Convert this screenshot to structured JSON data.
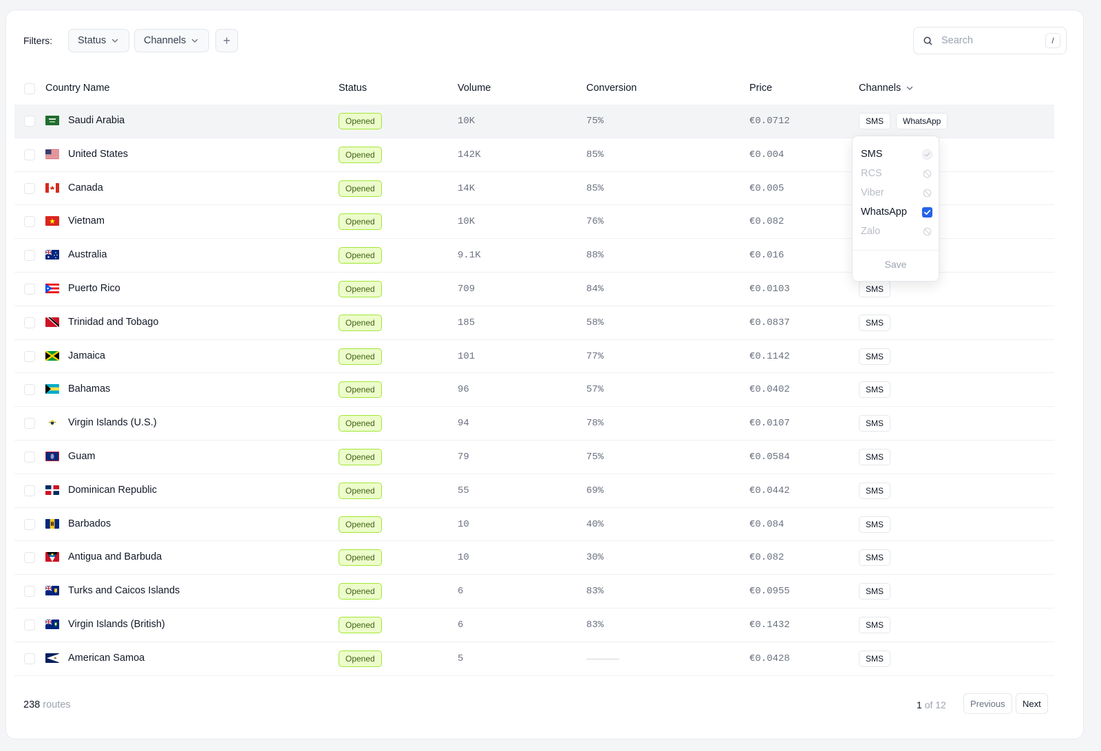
{
  "filters": {
    "label": "Filters:",
    "status_label": "Status",
    "channels_label": "Channels",
    "add_label": "+"
  },
  "search": {
    "placeholder": "Search",
    "shortcut": "/"
  },
  "table": {
    "headers": {
      "country": "Country Name",
      "status": "Status",
      "volume": "Volume",
      "conversion": "Conversion",
      "price": "Price",
      "channels": "Channels"
    },
    "rows": [
      {
        "country": "Saudi Arabia",
        "flag": "sa",
        "status": "Opened",
        "volume": "10K",
        "conversion": "75%",
        "price": "€0.0712",
        "channels": [
          "SMS",
          "WhatsApp"
        ]
      },
      {
        "country": "United States",
        "flag": "us",
        "status": "Opened",
        "volume": "142K",
        "conversion": "85%",
        "price": "€0.004",
        "channels": []
      },
      {
        "country": "Canada",
        "flag": "ca",
        "status": "Opened",
        "volume": "14K",
        "conversion": "85%",
        "price": "€0.005",
        "channels": []
      },
      {
        "country": "Vietnam",
        "flag": "vn",
        "status": "Opened",
        "volume": "10K",
        "conversion": "76%",
        "price": "€0.082",
        "channels": []
      },
      {
        "country": "Australia",
        "flag": "au",
        "status": "Opened",
        "volume": "9.1K",
        "conversion": "88%",
        "price": "€0.016",
        "channels": []
      },
      {
        "country": "Puerto Rico",
        "flag": "pr",
        "status": "Opened",
        "volume": "709",
        "conversion": "84%",
        "price": "€0.0103",
        "channels": [
          "SMS"
        ]
      },
      {
        "country": "Trinidad and Tobago",
        "flag": "tt",
        "status": "Opened",
        "volume": "185",
        "conversion": "58%",
        "price": "€0.0837",
        "channels": [
          "SMS"
        ]
      },
      {
        "country": "Jamaica",
        "flag": "jm",
        "status": "Opened",
        "volume": "101",
        "conversion": "77%",
        "price": "€0.1142",
        "channels": [
          "SMS"
        ]
      },
      {
        "country": "Bahamas",
        "flag": "bs",
        "status": "Opened",
        "volume": "96",
        "conversion": "57%",
        "price": "€0.0402",
        "channels": [
          "SMS"
        ]
      },
      {
        "country": "Virgin Islands (U.S.)",
        "flag": "vi",
        "status": "Opened",
        "volume": "94",
        "conversion": "78%",
        "price": "€0.0107",
        "channels": [
          "SMS"
        ]
      },
      {
        "country": "Guam",
        "flag": "gu",
        "status": "Opened",
        "volume": "79",
        "conversion": "75%",
        "price": "€0.0584",
        "channels": [
          "SMS"
        ]
      },
      {
        "country": "Dominican Republic",
        "flag": "do",
        "status": "Opened",
        "volume": "55",
        "conversion": "69%",
        "price": "€0.0442",
        "channels": [
          "SMS"
        ]
      },
      {
        "country": "Barbados",
        "flag": "bb",
        "status": "Opened",
        "volume": "10",
        "conversion": "40%",
        "price": "€0.084",
        "channels": [
          "SMS"
        ]
      },
      {
        "country": "Antigua and Barbuda",
        "flag": "ag",
        "status": "Opened",
        "volume": "10",
        "conversion": "30%",
        "price": "€0.082",
        "channels": [
          "SMS"
        ]
      },
      {
        "country": "Turks and Caicos Islands",
        "flag": "tc",
        "status": "Opened",
        "volume": "6",
        "conversion": "83%",
        "price": "€0.0955",
        "channels": [
          "SMS"
        ]
      },
      {
        "country": "Virgin Islands (British)",
        "flag": "vg",
        "status": "Opened",
        "volume": "6",
        "conversion": "83%",
        "price": "€0.1432",
        "channels": [
          "SMS"
        ]
      },
      {
        "country": "American Samoa",
        "flag": "as",
        "status": "Opened",
        "volume": "5",
        "conversion": "",
        "price": "€0.0428",
        "channels": [
          "SMS"
        ]
      }
    ]
  },
  "channel_dropdown": {
    "options": [
      {
        "label": "SMS",
        "state": "locked"
      },
      {
        "label": "RCS",
        "state": "disabled"
      },
      {
        "label": "Viber",
        "state": "disabled"
      },
      {
        "label": "WhatsApp",
        "state": "checked"
      },
      {
        "label": "Zalo",
        "state": "disabled"
      }
    ],
    "save_label": "Save"
  },
  "footer": {
    "count": "238",
    "count_label": "routes",
    "page_current": "1",
    "page_of": "of 12",
    "previous_label": "Previous",
    "next_label": "Next"
  },
  "colors": {
    "badge_bg": "#ecfccb",
    "badge_border": "#a3e635",
    "badge_text": "#3f6212",
    "accent": "#2563eb"
  }
}
